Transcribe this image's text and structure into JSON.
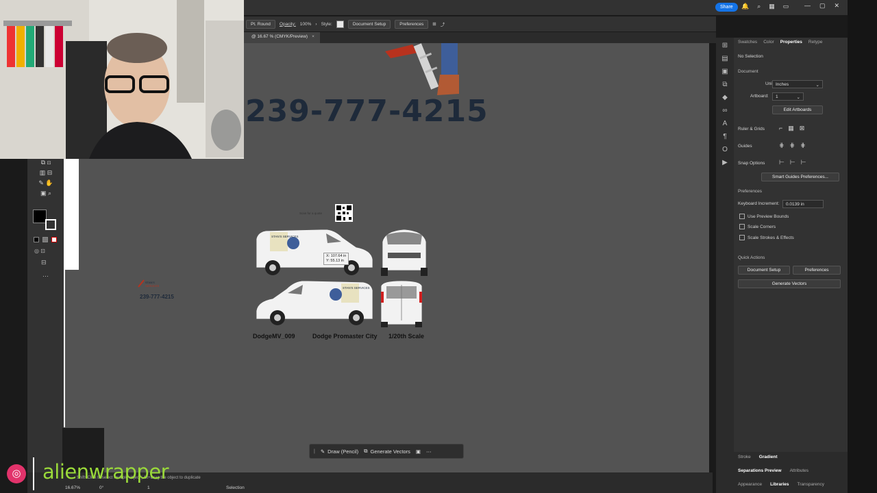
{
  "control_bar": {
    "stroke_style": "Pt. Round",
    "opacity_label": "Opacity:",
    "opacity_value": "100%",
    "style_label": "Style:",
    "doc_setup": "Document Setup",
    "preferences": "Preferences"
  },
  "doc_tab": {
    "title": "@ 16.67 % (CMYK/Preview)",
    "close": "×"
  },
  "share": "Share",
  "canvas": {
    "phone_big": "239-777-4215",
    "phone_small": "239-777-4215",
    "scan_text": "Scan for a quote",
    "captions": [
      "DodgeMV_009",
      "Dodge Promaster City",
      "1/20th Scale"
    ],
    "van_text": "STAN'S SERVICES",
    "coord_x": "X: 107.64 in",
    "coord_y": "Y: 55.13 in"
  },
  "context_bar": {
    "draw": "Draw (Pencil)",
    "generate": "Generate Vectors"
  },
  "status": {
    "hint": "Shift+Click to select multiple object | Alt+Drag the object to duplicate",
    "zoom": "16.67%",
    "rotation": "0°",
    "page": "1",
    "tool": "Selection"
  },
  "panel": {
    "tabs": [
      "Swatches",
      "Color",
      "Properties",
      "Retype"
    ],
    "no_selection": "No Selection",
    "document": "Document",
    "units_label": "Units:",
    "units_value": "Inches",
    "artboard_label": "Artboard:",
    "artboard_value": "1",
    "edit_artboards": "Edit Artboards",
    "rulers_grids": "Ruler & Grids",
    "guides": "Guides",
    "snap_options": "Snap Options",
    "smart_guides": "Smart Guides Preferences...",
    "preferences": "Preferences",
    "keyboard_inc_label": "Keyboard Increment:",
    "keyboard_inc_value": "0.0139 in",
    "use_preview_bounds": "Use Preview Bounds",
    "scale_corners": "Scale Corners",
    "scale_strokes": "Scale Strokes & Effects",
    "quick_actions": "Quick Actions",
    "qa_doc_setup": "Document Setup",
    "qa_preferences": "Preferences",
    "qa_generate": "Generate Vectors"
  },
  "bottom_panel": {
    "row1": [
      "Stroke",
      "Gradient"
    ],
    "row2": [
      "Separations Preview",
      "Attributes"
    ],
    "row3": [
      "Appearance",
      "Libraries",
      "Transparency"
    ]
  },
  "watermark": {
    "brand": "alienwrapper"
  }
}
